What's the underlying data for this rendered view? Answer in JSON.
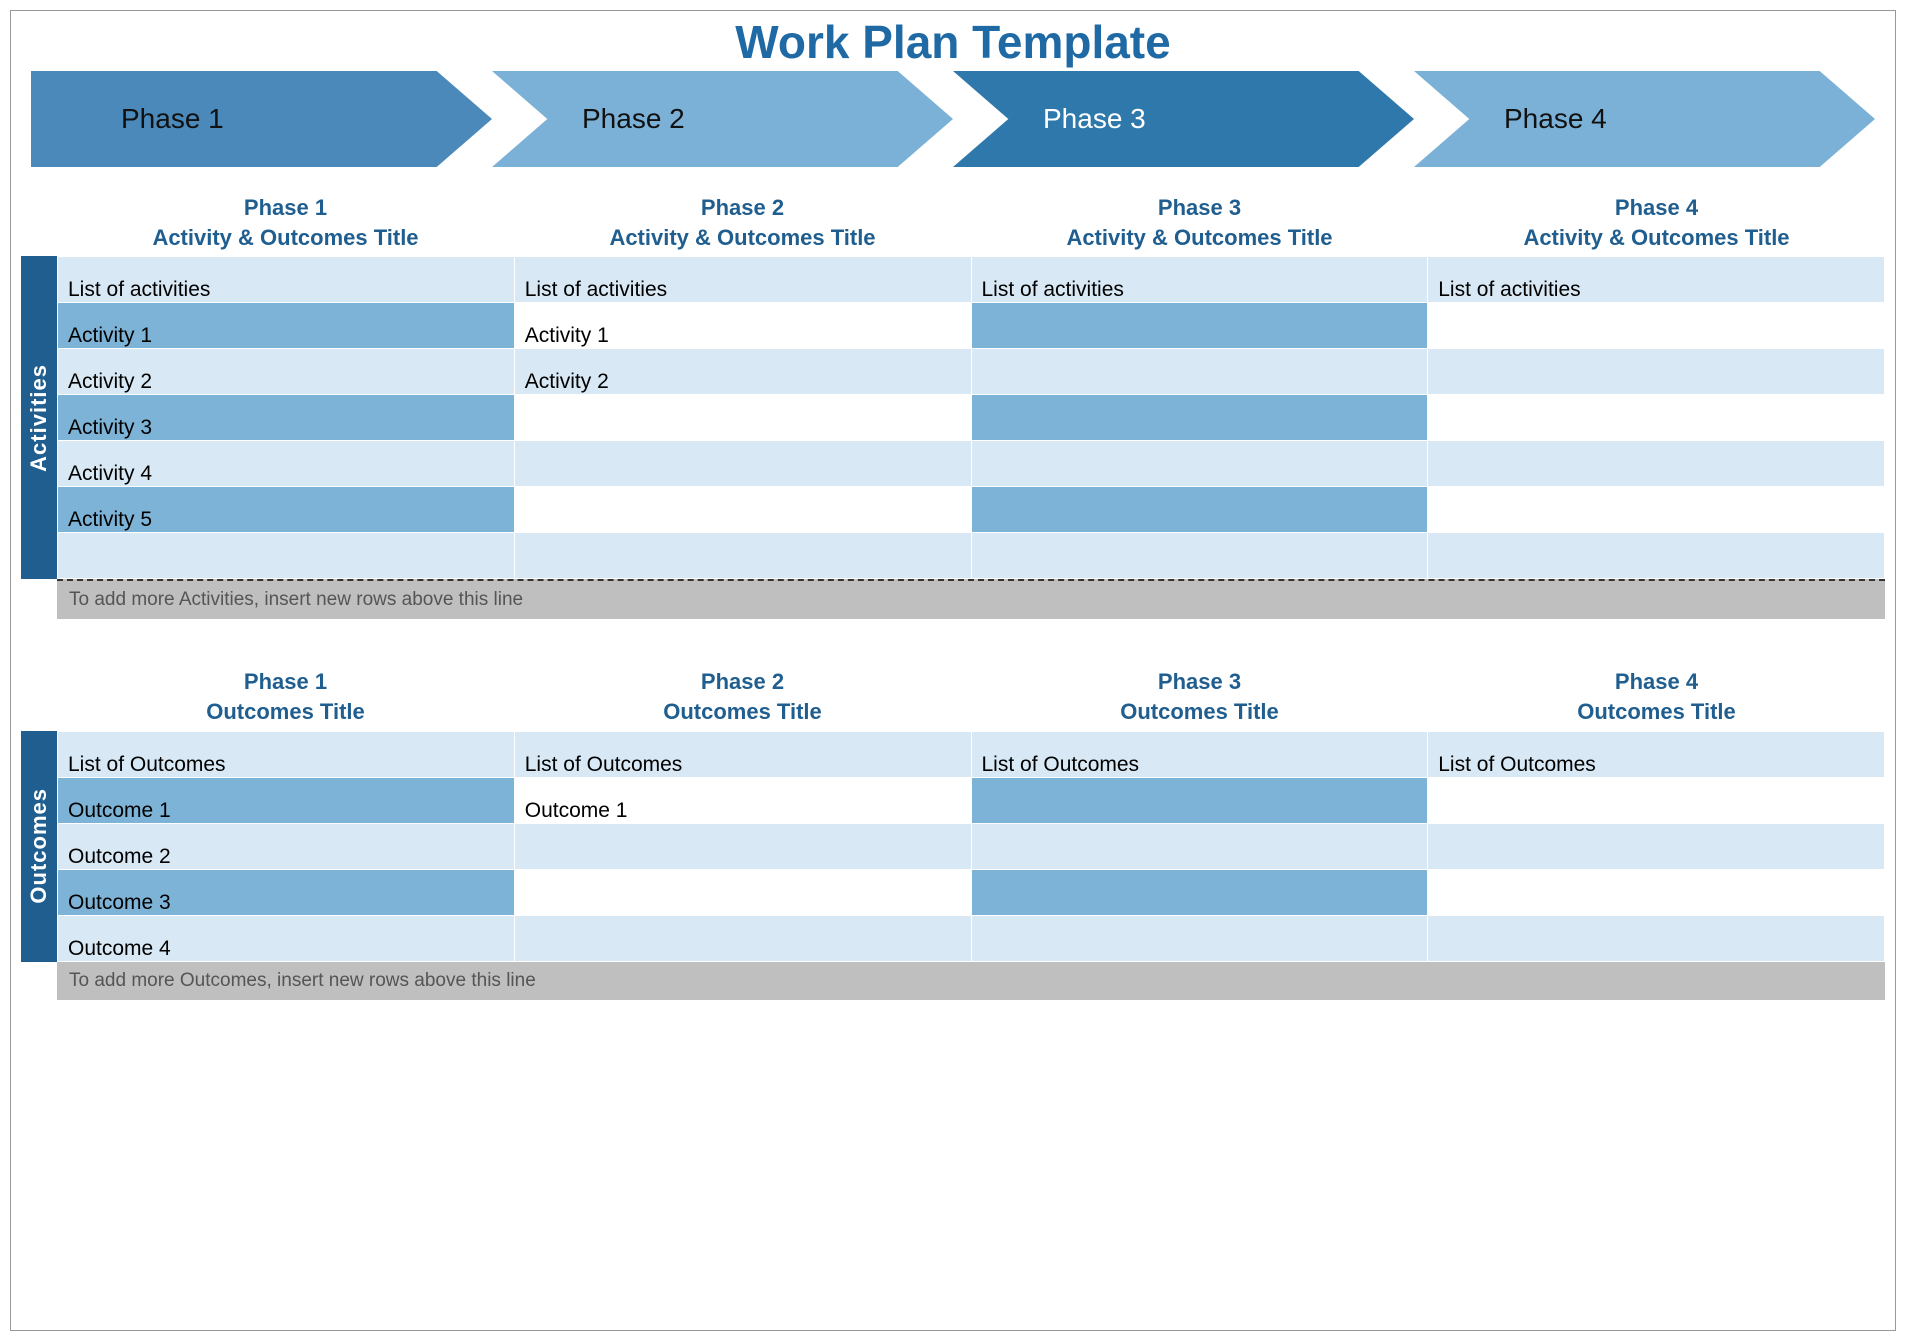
{
  "title": "Work Plan Template",
  "phases": {
    "p1": "Phase 1",
    "p2": "Phase 2",
    "p3": "Phase 3",
    "p4": "Phase 4"
  },
  "arrow_colors": {
    "p1": "#4a89b9",
    "p2": "#7bb1d6",
    "p3": "#2f78ab",
    "p4": "#7bb1d6"
  },
  "sections": {
    "activities": {
      "side_label": "Activities",
      "headers": {
        "p1": {
          "line1": "Phase 1",
          "line2": "Activity & Outcomes Title"
        },
        "p2": {
          "line1": "Phase 2",
          "line2": "Activity & Outcomes Title"
        },
        "p3": {
          "line1": "Phase 3",
          "line2": "Activity & Outcomes Title"
        },
        "p4": {
          "line1": "Phase 4",
          "line2": "Activity & Outcomes Title"
        }
      },
      "rows": {
        "r0": {
          "p1": "List of activities",
          "p2": "List of activities",
          "p3": "List of activities",
          "p4": "List of activities",
          "fill": {
            "p1": false,
            "p2": false,
            "p3": false,
            "p4": false
          }
        },
        "r1": {
          "p1": "Activity 1",
          "p2": "Activity 1",
          "p3": "",
          "p4": "",
          "fill": {
            "p1": true,
            "p2": false,
            "p3": true,
            "p4": false
          }
        },
        "r2": {
          "p1": "Activity 2",
          "p2": "Activity 2",
          "p3": "",
          "p4": "",
          "fill": {
            "p1": false,
            "p2": false,
            "p3": false,
            "p4": false
          }
        },
        "r3": {
          "p1": "Activity 3",
          "p2": "",
          "p3": "",
          "p4": "",
          "fill": {
            "p1": true,
            "p2": false,
            "p3": true,
            "p4": false
          }
        },
        "r4": {
          "p1": "Activity 4",
          "p2": "",
          "p3": "",
          "p4": "",
          "fill": {
            "p1": false,
            "p2": false,
            "p3": false,
            "p4": false
          }
        },
        "r5": {
          "p1": "Activity 5",
          "p2": "",
          "p3": "",
          "p4": "",
          "fill": {
            "p1": true,
            "p2": false,
            "p3": true,
            "p4": false
          }
        },
        "r6": {
          "p1": "",
          "p2": "",
          "p3": "",
          "p4": "",
          "fill": {
            "p1": false,
            "p2": false,
            "p3": false,
            "p4": false
          }
        }
      },
      "note": "To add more Activities, insert new rows above this line"
    },
    "outcomes": {
      "side_label": "Outcomes",
      "headers": {
        "p1": {
          "line1": "Phase 1",
          "line2": "Outcomes Title"
        },
        "p2": {
          "line1": "Phase 2",
          "line2": "Outcomes Title"
        },
        "p3": {
          "line1": "Phase 3",
          "line2": "Outcomes Title"
        },
        "p4": {
          "line1": "Phase 4",
          "line2": "Outcomes Title"
        }
      },
      "rows": {
        "r0": {
          "p1": "List of Outcomes",
          "p2": "List of Outcomes",
          "p3": "List of Outcomes",
          "p4": "List of Outcomes",
          "fill": {
            "p1": false,
            "p2": false,
            "p3": false,
            "p4": false
          }
        },
        "r1": {
          "p1": "Outcome 1",
          "p2": "Outcome 1",
          "p3": "",
          "p4": "",
          "fill": {
            "p1": true,
            "p2": false,
            "p3": true,
            "p4": false
          }
        },
        "r2": {
          "p1": "Outcome 2",
          "p2": "",
          "p3": "",
          "p4": "",
          "fill": {
            "p1": false,
            "p2": false,
            "p3": false,
            "p4": false
          }
        },
        "r3": {
          "p1": "Outcome 3",
          "p2": "",
          "p3": "",
          "p4": "",
          "fill": {
            "p1": true,
            "p2": false,
            "p3": true,
            "p4": false
          }
        },
        "r4": {
          "p1": "Outcome 4",
          "p2": "",
          "p3": "",
          "p4": "",
          "fill": {
            "p1": false,
            "p2": false,
            "p3": false,
            "p4": false
          }
        }
      },
      "note": "To add more Outcomes, insert new rows above this line"
    }
  }
}
